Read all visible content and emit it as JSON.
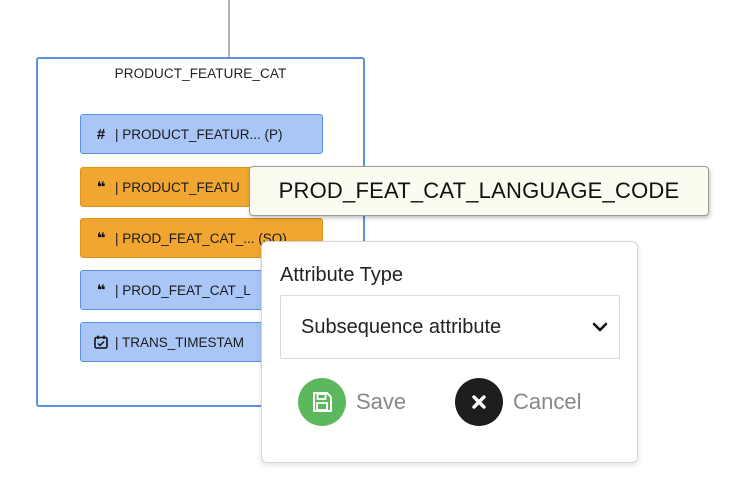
{
  "entity": {
    "title": "PRODUCT_FEATURE_CAT",
    "attributes": [
      {
        "icon": "hash-icon",
        "text": "| PRODUCT_FEATUR... (P)",
        "color": "#a9c6f7"
      },
      {
        "icon": "quote-icon",
        "text": "| PRODUCT_FEATU",
        "color": "#f0a630"
      },
      {
        "icon": "quote-icon",
        "text": "| PROD_FEAT_CAT_... (SQ)",
        "color": "#f0a630"
      },
      {
        "icon": "quote-icon",
        "text": "| PROD_FEAT_CAT_L",
        "color": "#a9c6f7"
      },
      {
        "icon": "calendar-icon",
        "text": "| TRANS_TIMESTAM",
        "color": "#a9c6f7"
      }
    ]
  },
  "tooltip": {
    "text": "PROD_FEAT_CAT_LANGUAGE_CODE"
  },
  "popup": {
    "label": "Attribute Type",
    "select_value": "Subsequence attribute",
    "save_label": "Save",
    "cancel_label": "Cancel",
    "save_color": "#5cb85c",
    "cancel_color": "#1e1e1e"
  }
}
